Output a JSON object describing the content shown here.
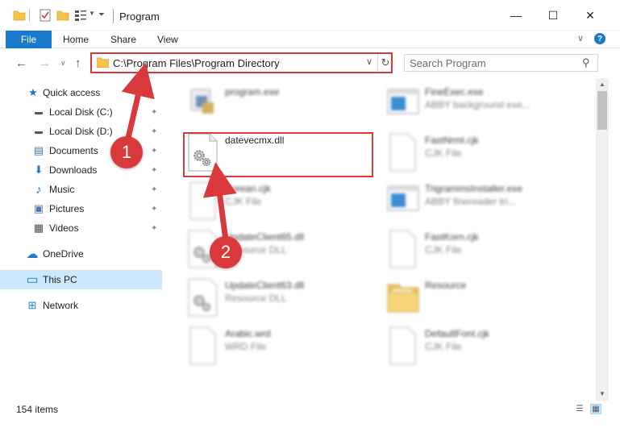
{
  "window": {
    "title": "Program",
    "minimize_glyph": "—",
    "maximize_glyph": "☐",
    "close_glyph": "✕"
  },
  "ribbon": {
    "file_label": "File",
    "tabs": [
      "Home",
      "Share",
      "View"
    ],
    "help_glyph": "?",
    "collapse_glyph": "∨"
  },
  "address": {
    "path": "C:\\Program Files\\Program Directory",
    "dropdown_glyph": "∨",
    "refresh_glyph": "↻"
  },
  "search": {
    "placeholder": "Search Program"
  },
  "nav_buttons": {
    "back": "←",
    "forward": "→",
    "recent": "∨",
    "up": "↑"
  },
  "sidebar": {
    "items": [
      {
        "label": "Quick access",
        "icon": "star-icon",
        "glyph": "★",
        "color": "#1979ca",
        "pinned": false
      },
      {
        "label": "Local Disk (C:)",
        "icon": "drive-icon",
        "glyph": "▬",
        "color": "#5a5a5a",
        "pinned": true
      },
      {
        "label": "Local Disk (D:)",
        "icon": "drive-icon",
        "glyph": "▬",
        "color": "#5a5a5a",
        "pinned": true
      },
      {
        "label": "Documents",
        "icon": "documents-icon",
        "glyph": "▤",
        "color": "#4a76b0",
        "pinned": true
      },
      {
        "label": "Downloads",
        "icon": "download-icon",
        "glyph": "⬇",
        "color": "#1979ca",
        "pinned": true
      },
      {
        "label": "Music",
        "icon": "music-icon",
        "glyph": "♪",
        "color": "#1979ca",
        "pinned": true
      },
      {
        "label": "Pictures",
        "icon": "pictures-icon",
        "glyph": "▣",
        "color": "#4a76b0",
        "pinned": true
      },
      {
        "label": "Videos",
        "icon": "videos-icon",
        "glyph": "▦",
        "color": "#4a4a4a",
        "pinned": true
      },
      {
        "label": "OneDrive",
        "icon": "cloud-icon",
        "glyph": "☁",
        "color": "#1979ca",
        "pinned": false
      },
      {
        "label": "This PC",
        "icon": "computer-icon",
        "glyph": "▭",
        "color": "#1979ca",
        "pinned": false
      },
      {
        "label": "Network",
        "icon": "network-icon",
        "glyph": "⊞",
        "color": "#1979ca",
        "pinned": false
      }
    ],
    "pin_glyph": "📌"
  },
  "files": [
    {
      "name": "program.exe",
      "type": "",
      "icon": "exe-icon",
      "blurred": true
    },
    {
      "name": "FineExec.exe",
      "type": "ABBY background exe...",
      "icon": "app-window-icon",
      "blurred": true
    },
    {
      "name": "datevecmx.dll",
      "type": "",
      "icon": "dll-gear-icon",
      "blurred": false
    },
    {
      "name": "FastNrml.cjk",
      "type": "CJK File",
      "icon": "file-icon",
      "blurred": true
    },
    {
      "name": "Eprean.cjk",
      "type": "CJK File",
      "icon": "file-icon",
      "blurred": true
    },
    {
      "name": "TrigrammsInstaller.exe",
      "type": "ABBY finereader tri...",
      "icon": "app-window-icon",
      "blurred": true
    },
    {
      "name": "UpdateClient65.dll",
      "type": "Resource DLL",
      "icon": "dll-gear-icon",
      "blurred": true
    },
    {
      "name": "FastKorn.cjk",
      "type": "CJK File",
      "icon": "file-icon",
      "blurred": true
    },
    {
      "name": "UpdateClient63.dll",
      "type": "Resource DLL",
      "icon": "dll-gear-icon",
      "blurred": true
    },
    {
      "name": "Resource",
      "type": "",
      "icon": "folder-icon",
      "blurred": true
    },
    {
      "name": "Arabic.wrd",
      "type": "WRD File",
      "icon": "file-icon",
      "blurred": true
    },
    {
      "name": "DefaultFont.cjk",
      "type": "CJK File",
      "icon": "file-icon",
      "blurred": true
    }
  ],
  "status": {
    "item_count": "154 items"
  },
  "annotations": {
    "callout_1": "1",
    "callout_2": "2",
    "accent_color": "#d9393b"
  },
  "colors": {
    "accent": "#1979ca",
    "selection": "#cce8ff",
    "highlight": "#d9393b"
  }
}
